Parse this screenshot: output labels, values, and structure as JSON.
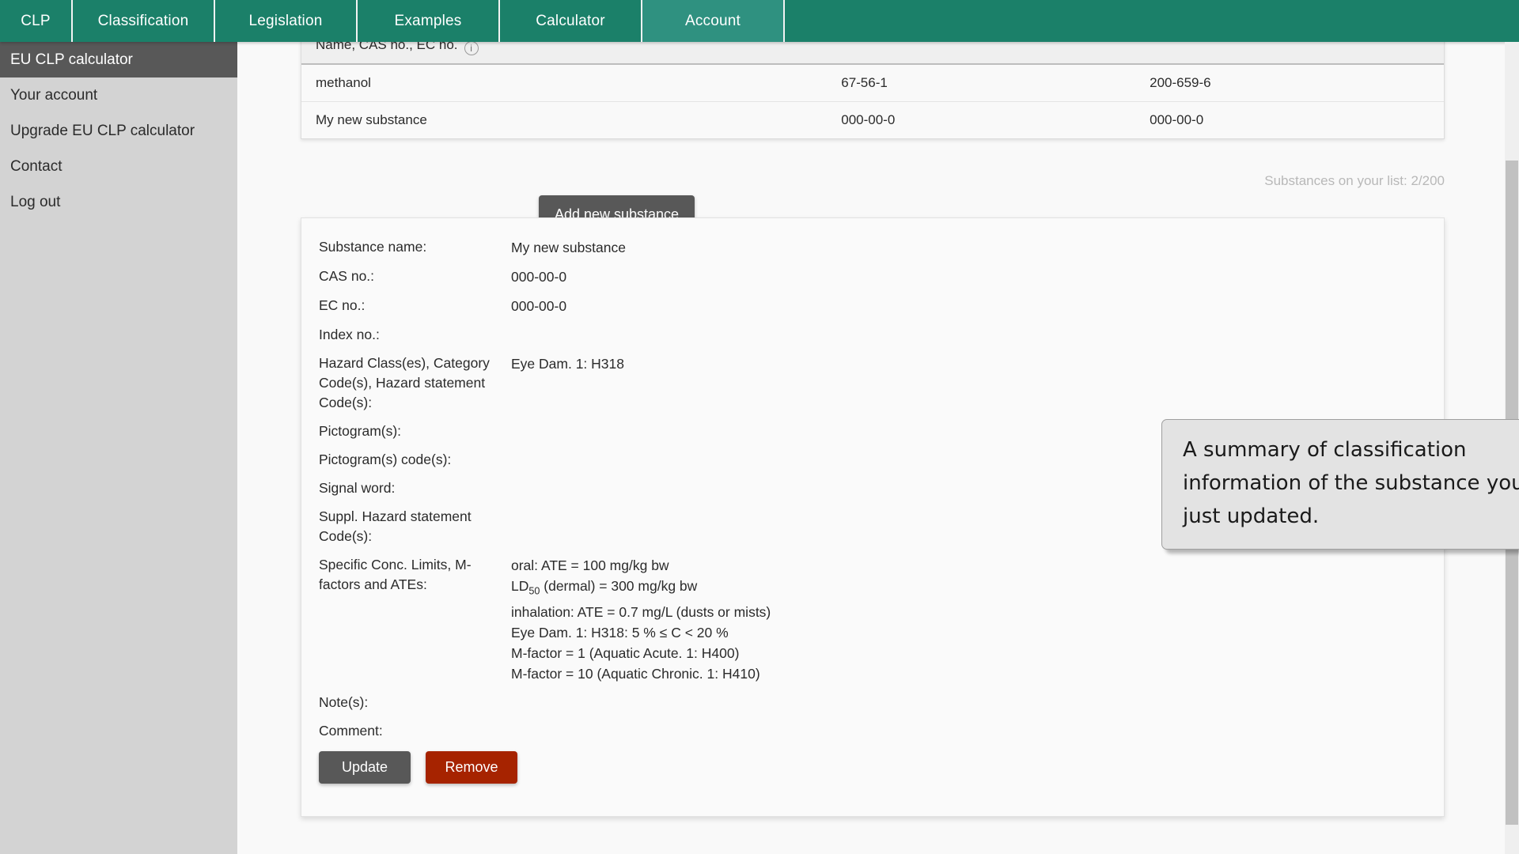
{
  "topnav": {
    "items": [
      {
        "label": "CLP",
        "active": false
      },
      {
        "label": "Classification",
        "active": false
      },
      {
        "label": "Legislation",
        "active": false
      },
      {
        "label": "Examples",
        "active": false
      },
      {
        "label": "Calculator",
        "active": false
      },
      {
        "label": "Account",
        "active": true
      }
    ],
    "background_color": "#1b8069",
    "active_color": "#2f9180"
  },
  "sidebar": {
    "items": [
      {
        "label": "EU CLP calculator",
        "active": true
      },
      {
        "label": "Your account",
        "active": false
      },
      {
        "label": "Upgrade EU CLP calculator",
        "active": false
      },
      {
        "label": "Contact",
        "active": false
      },
      {
        "label": "Log out",
        "active": false
      }
    ],
    "background_color": "#d3d3d3",
    "active_color": "#585858"
  },
  "substance_table": {
    "header": {
      "name_col": "Name, CAS no., EC no.",
      "info_icon": "i"
    },
    "rows": [
      {
        "name": "methanol",
        "cas": "67-56-1",
        "ec": "200-659-6"
      },
      {
        "name": "My new substance",
        "cas": "000-00-0",
        "ec": "000-00-0"
      }
    ],
    "counter": "Substances on your list: 2/200"
  },
  "actions": {
    "add_new_substance": "Add new substance",
    "update": "Update",
    "remove": "Remove"
  },
  "detail": {
    "labels": {
      "substance_name": "Substance name:",
      "cas_no": "CAS no.:",
      "ec_no": "EC no.:",
      "index_no": "Index no.:",
      "hazard_class": "Hazard Class(es), Category Code(s), Hazard statement Code(s):",
      "pictograms": "Pictogram(s):",
      "pictogram_codes": "Pictogram(s) code(s):",
      "signal_word": "Signal word:",
      "suppl_hazard": "Suppl. Hazard statement Code(s):",
      "conc_limits": "Specific Conc. Limits, M-factors and ATEs:",
      "notes": "Note(s):",
      "comment": "Comment:"
    },
    "values": {
      "substance_name": "My new substance",
      "cas_no": "000-00-0",
      "ec_no": "000-00-0",
      "index_no": "",
      "hazard_class": "Eye Dam. 1: H318",
      "pictograms": "",
      "pictogram_codes": "",
      "signal_word": "",
      "suppl_hazard": "",
      "conc_limits_lines": [
        "oral: ATE = 100 mg/kg bw",
        "LD50 (dermal) = 300 mg/kg bw",
        "inhalation: ATE = 0.7 mg/L (dusts or mists)",
        "Eye Dam. 1: H318: 5 % ≤ C < 20 %",
        "M-factor = 1 (Aquatic Acute. 1: H400)",
        "M-factor = 10 (Aquatic Chronic. 1: H410)"
      ],
      "conc_limits_line2_pre": "LD",
      "conc_limits_line2_sub": "50",
      "conc_limits_line2_post": " (dermal) = 300 mg/kg bw",
      "notes": "",
      "comment": ""
    }
  },
  "callout": {
    "text": "A summary of classification information of the substance you just updated.",
    "background_color": "#e3e3e3",
    "border_color": "#9f9f9f"
  }
}
